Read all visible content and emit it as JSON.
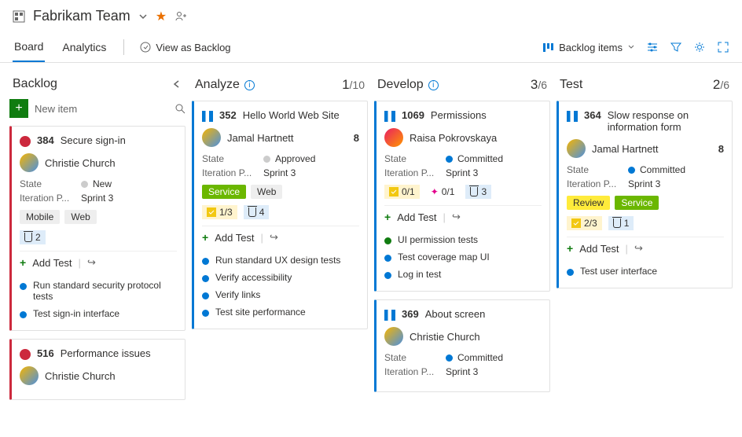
{
  "header": {
    "title": "Fabrikam Team"
  },
  "tabs": {
    "board": "Board",
    "analytics": "Analytics",
    "viewAsBacklog": "View as Backlog"
  },
  "toolbar": {
    "backlogItems": "Backlog items"
  },
  "columns": {
    "backlog": {
      "title": "Backlog",
      "newItem": "New item"
    },
    "analyze": {
      "title": "Analyze",
      "count": "1",
      "limit": "/10"
    },
    "develop": {
      "title": "Develop",
      "count": "3",
      "limit": "/6"
    },
    "test": {
      "title": "Test",
      "count": "2",
      "limit": "/6"
    }
  },
  "addTest": "Add Test",
  "cards": {
    "c384": {
      "id": "384",
      "title": "Secure sign-in",
      "assignee": "Christie Church",
      "state": "New",
      "iteration": "Sprint 3",
      "tags": [
        "Mobile",
        "Web"
      ],
      "testCount": "2",
      "tests": [
        "Run standard security protocol tests",
        "Test sign-in interface"
      ]
    },
    "c516": {
      "id": "516",
      "title": "Performance issues",
      "assignee": "Christie Church"
    },
    "c352": {
      "id": "352",
      "title": "Hello World Web Site",
      "assignee": "Jamal Hartnett",
      "effort": "8",
      "state": "Approved",
      "iteration": "Sprint 3",
      "tasks": "1/3",
      "testCount": "4",
      "tests": [
        "Run standard UX design tests",
        "Verify accessibility",
        "Verify links",
        "Test site performance"
      ]
    },
    "c1069": {
      "id": "1069",
      "title": "Permissions",
      "assignee": "Raisa Pokrovskaya",
      "state": "Committed",
      "iteration": "Sprint 3",
      "tasks": "0/1",
      "bugs": "0/1",
      "testCount": "3",
      "tests": [
        "UI permission tests",
        "Test coverage map UI",
        "Log in test"
      ]
    },
    "c369": {
      "id": "369",
      "title": "About screen",
      "assignee": "Christie Church",
      "state": "Committed",
      "iteration": "Sprint 3"
    },
    "c364": {
      "id": "364",
      "title": "Slow response on information form",
      "assignee": "Jamal Hartnett",
      "effort": "8",
      "state": "Committed",
      "iteration": "Sprint 3",
      "tasks": "2/3",
      "testCount": "1",
      "tests": [
        "Test user interface"
      ]
    }
  },
  "labels": {
    "state": "State",
    "iteration": "Iteration P..."
  }
}
